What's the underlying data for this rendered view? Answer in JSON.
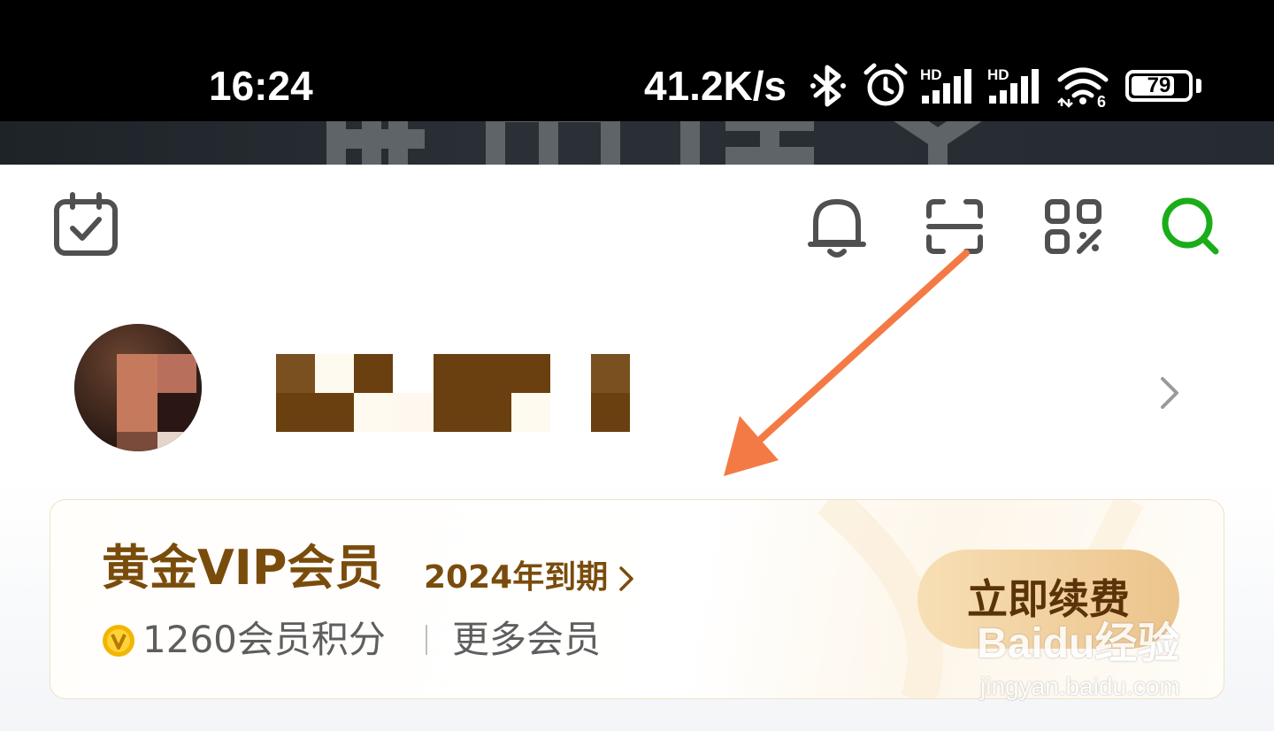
{
  "status_bar": {
    "time": "16:24",
    "network_speed": "41.2K/s",
    "battery_level": "79",
    "battery_fraction": 0.79,
    "icons": [
      "bluetooth-icon",
      "alarm-icon",
      "signal-hd-1-icon",
      "signal-hd-2-icon",
      "wifi-6-icon",
      "battery-icon"
    ]
  },
  "toolbar": {
    "icons": [
      "calendar-check-icon",
      "bell-icon",
      "scan-icon",
      "qr-code-icon",
      "search-icon"
    ],
    "accent_color": "#1aad19"
  },
  "vip": {
    "title": "黄金VIP会员",
    "expire": "2024年到期",
    "points": "1260会员积分",
    "more": "更多会员",
    "renew_label": "立即续费",
    "title_color": "#7a4c0c"
  },
  "watermark": {
    "brand": "Baidu经验",
    "url": "jingyan.baidu.com"
  },
  "annotation": {
    "arrow_color": "#f47a45"
  }
}
